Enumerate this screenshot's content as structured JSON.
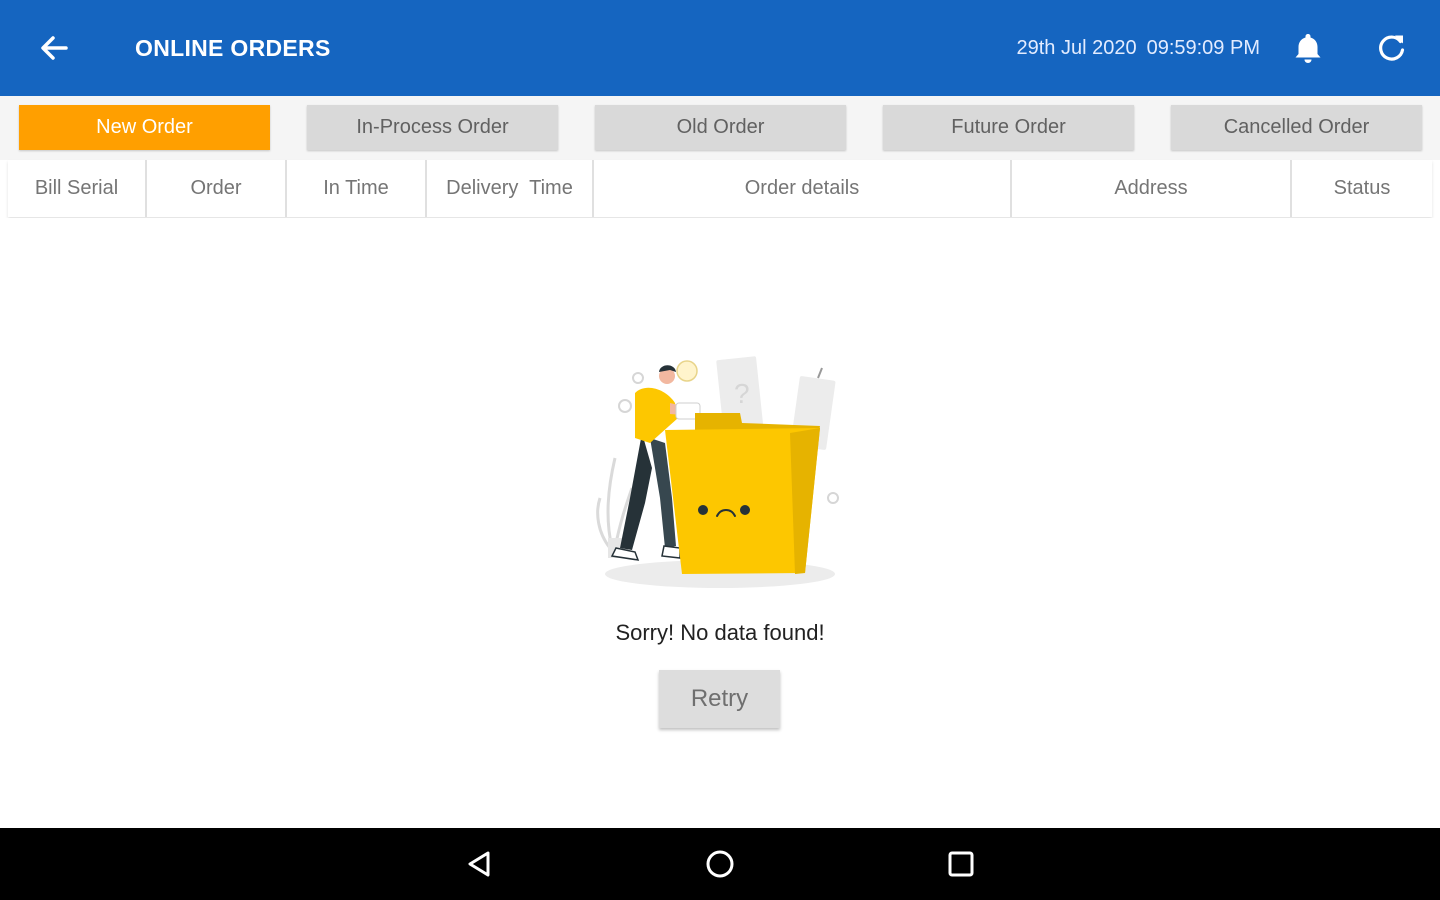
{
  "app_bar": {
    "title": "ONLINE ORDERS",
    "date": "29th Jul 2020",
    "time": "09:59:09 PM",
    "back_icon": "arrow-left-icon",
    "bell_icon": "bell-icon",
    "refresh_icon": "refresh-icon",
    "background_color": "#1565c0"
  },
  "tabs": [
    {
      "label": "New Order",
      "active": true
    },
    {
      "label": "In-Process Order",
      "active": false
    },
    {
      "label": "Old Order",
      "active": false
    },
    {
      "label": "Future Order",
      "active": false
    },
    {
      "label": "Cancelled Order",
      "active": false
    }
  ],
  "tab_colors": {
    "active": "#ff9f00",
    "inactive": "#d9d9d9"
  },
  "table": {
    "columns": [
      "Bill Serial",
      "Order",
      "In Time",
      "Delivery  Time",
      "Order details",
      "Address",
      "Status"
    ],
    "rows": []
  },
  "empty_state": {
    "illustration": "empty-folder-illustration",
    "message": "Sorry! No data found!",
    "retry_label": "Retry"
  },
  "nav_bar": {
    "back_icon": "triangle-back-icon",
    "home_icon": "circle-home-icon",
    "recents_icon": "square-recents-icon"
  }
}
